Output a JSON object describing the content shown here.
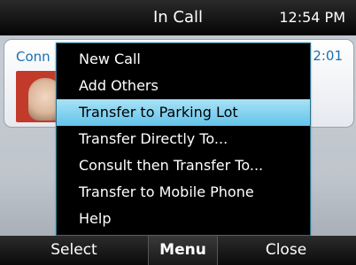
{
  "status_bar": {
    "title": "In Call",
    "time": "12:54 PM"
  },
  "call": {
    "status_label": "Conn",
    "duration": "2:01"
  },
  "menu": {
    "items": [
      {
        "label": "New Call",
        "selected": false
      },
      {
        "label": "Add Others",
        "selected": false
      },
      {
        "label": "Transfer to Parking Lot",
        "selected": true
      },
      {
        "label": "Transfer Directly To...",
        "selected": false
      },
      {
        "label": "Consult then Transfer To...",
        "selected": false
      },
      {
        "label": "Transfer to Mobile Phone",
        "selected": false
      },
      {
        "label": "Help",
        "selected": false
      }
    ]
  },
  "softkeys": {
    "left": "Select",
    "middle": "Menu",
    "right": "Close"
  },
  "colors": {
    "highlight": "#7fd0ef",
    "accent": "#1b6fb0",
    "avatar_frame": "#c23a2a"
  }
}
